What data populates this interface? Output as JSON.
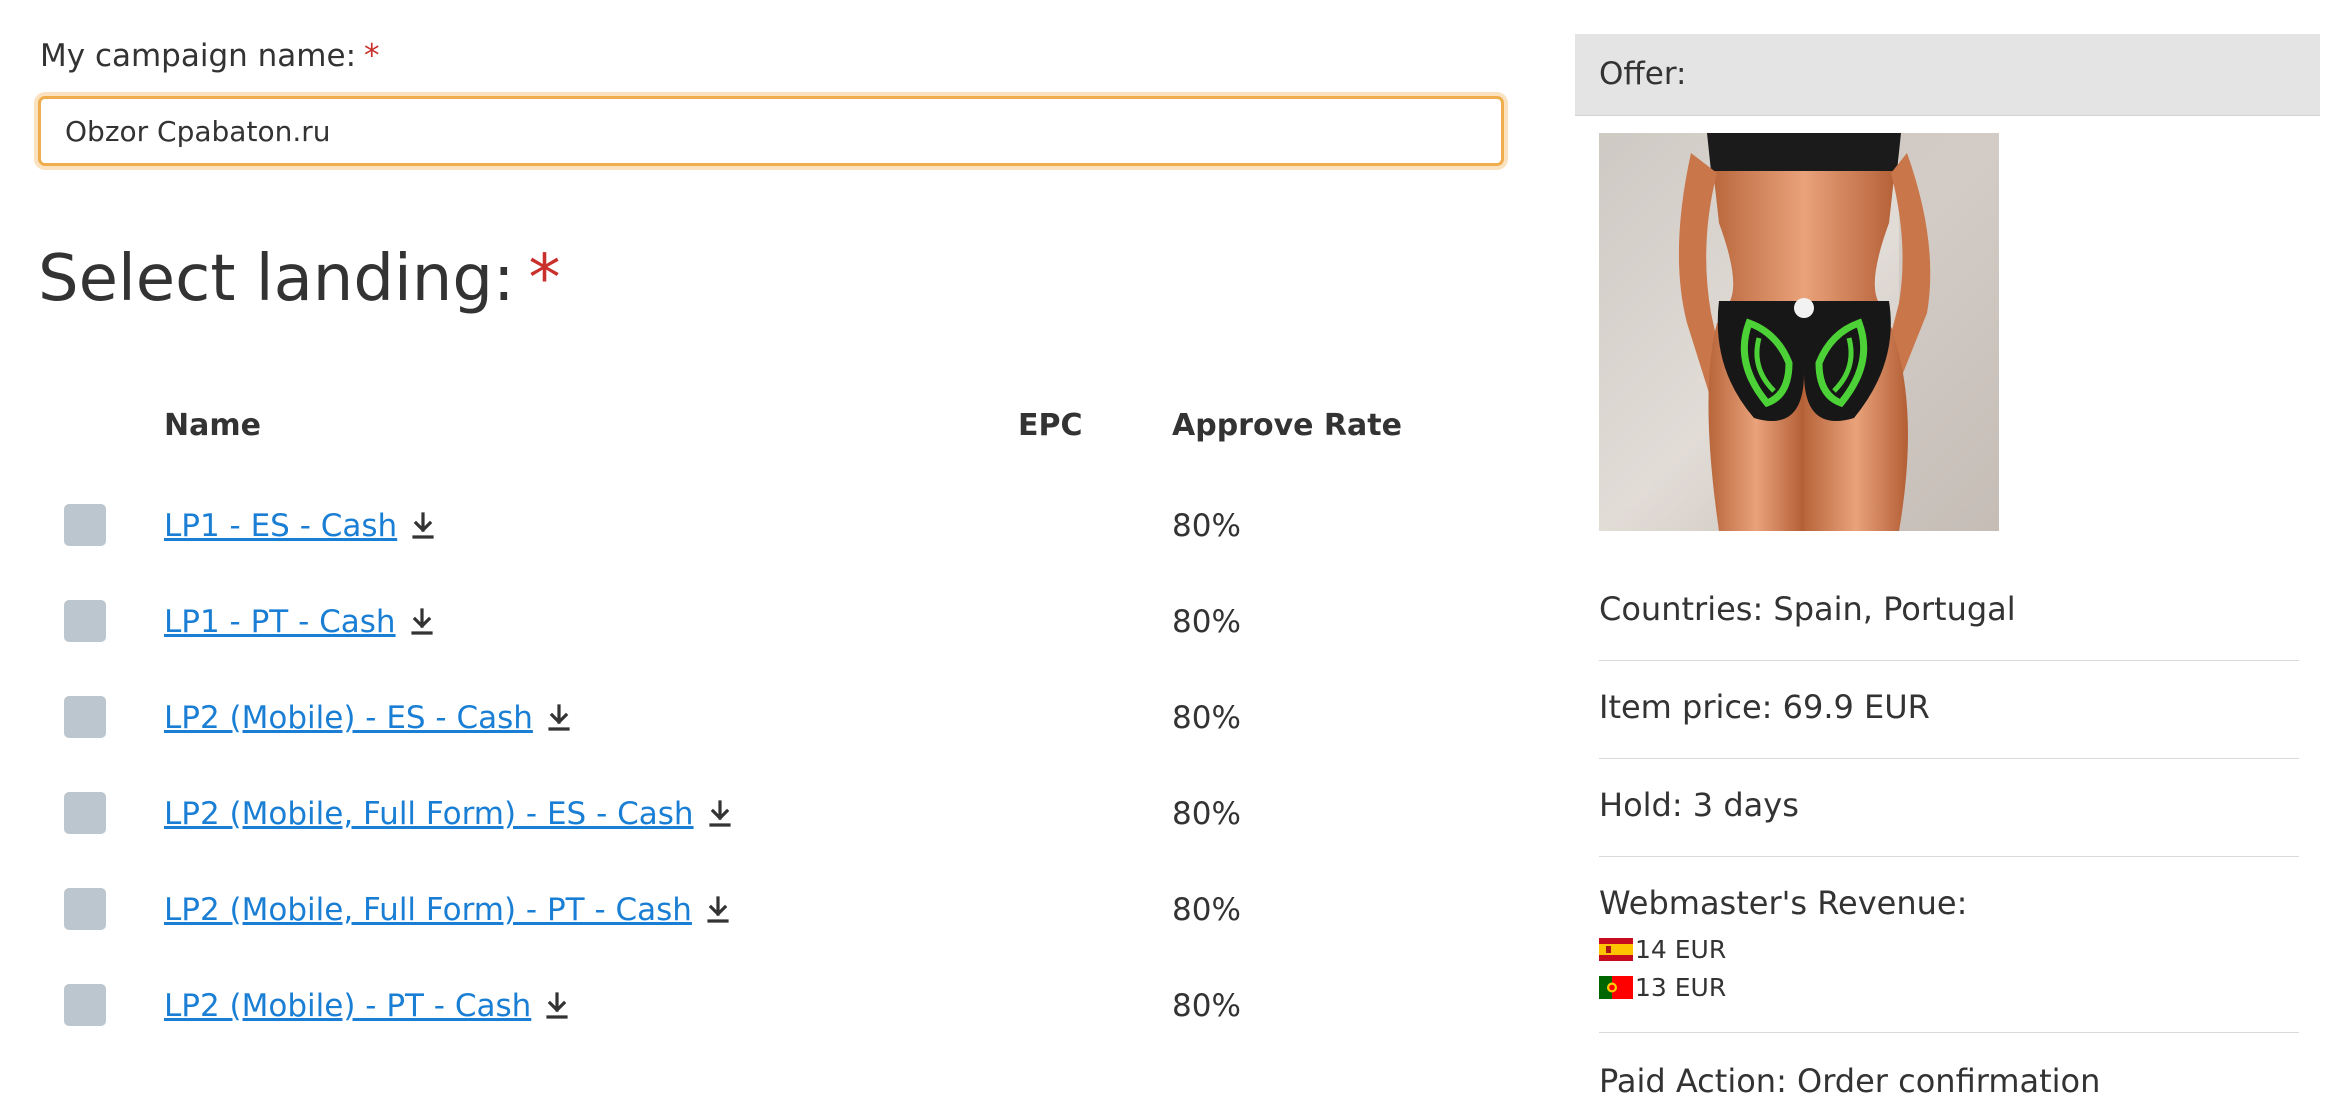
{
  "campaign": {
    "label": "My campaign name:",
    "required_mark": "*",
    "value": "Obzor Cpabaton.ru"
  },
  "landing": {
    "title": "Select landing:",
    "required_mark": "*",
    "columns": {
      "name": "Name",
      "epc": "EPC",
      "approve_rate": "Approve Rate"
    },
    "rows": [
      {
        "name": "LP1 - ES - Cash",
        "epc": "",
        "approve_rate": "80%"
      },
      {
        "name": "LP1 - PT - Cash",
        "epc": "",
        "approve_rate": "80%"
      },
      {
        "name": "LP2 (Mobile) - ES - Cash",
        "epc": "",
        "approve_rate": "80%"
      },
      {
        "name": "LP2 (Mobile, Full Form) - ES - Cash",
        "epc": "",
        "approve_rate": "80%"
      },
      {
        "name": "LP2 (Mobile, Full Form) - PT - Cash",
        "epc": "",
        "approve_rate": "80%"
      },
      {
        "name": "LP2 (Mobile) - PT - Cash",
        "epc": "",
        "approve_rate": "80%"
      }
    ]
  },
  "offer": {
    "header": "Offer:",
    "image_alt": "offer-product-photo",
    "countries": "Countries: Spain, Portugal",
    "item_price": "Item price: 69.9 EUR",
    "hold": "Hold: 3 days",
    "revenue_label": "Webmaster's Revenue:",
    "revenue": [
      {
        "flag": "spain-flag",
        "amount": "14 EUR"
      },
      {
        "flag": "portugal-flag",
        "amount": "13 EUR"
      }
    ],
    "paid_action": "Paid Action: Order confirmation"
  },
  "colors": {
    "link": "#1a7fd4",
    "required": "#c9302c",
    "input_focus_border": "#f0ad4e",
    "checkbox": "#bcc6ce",
    "offer_header_bg": "#e4e4e4"
  }
}
